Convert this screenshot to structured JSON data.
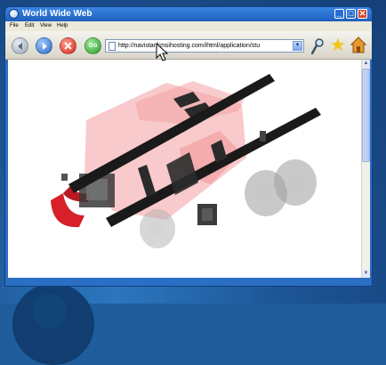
{
  "window": {
    "title": "World Wide Web",
    "controls": {
      "minimize": "_",
      "maximize": "□",
      "close": "✕"
    }
  },
  "menu": {
    "items": [
      {
        "label": "File"
      },
      {
        "label": "Edit"
      },
      {
        "label": "View"
      },
      {
        "label": "Help"
      }
    ]
  },
  "toolbar": {
    "back_icon": "back-arrow-icon",
    "forward_icon": "forward-arrow-icon",
    "stop_icon": "stop-x-icon",
    "go_label": "Go",
    "address": "http://navistar.kmsihosting.com/ihtml/application/stu",
    "dropdown_icon": "chevron-down-icon",
    "search_icon": "magnifier-icon",
    "favorites_icon": "star-icon",
    "home_icon": "home-icon"
  },
  "content": {
    "image_description_icon": "truck-chassis-diagram"
  },
  "colors": {
    "titlebar": "#2b6fc4",
    "truck_body": "#e8494c",
    "rail": "#1a1a1a"
  }
}
